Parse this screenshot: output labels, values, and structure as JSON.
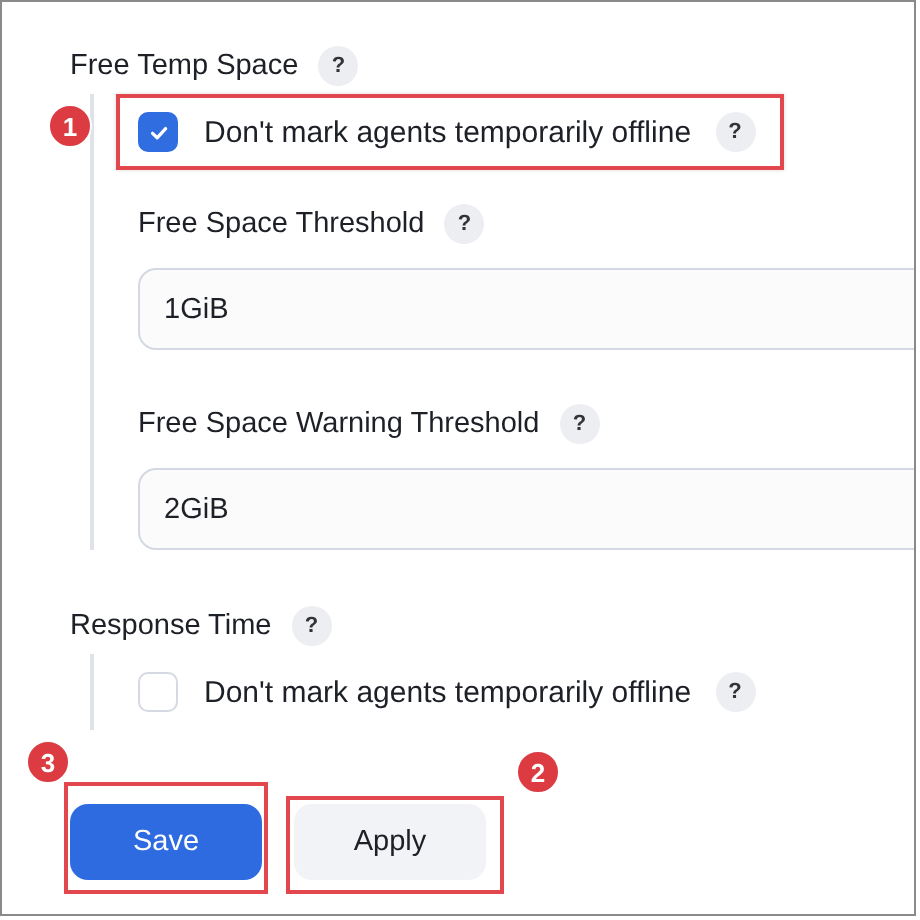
{
  "sections": [
    {
      "title": "Free Temp Space",
      "help": "?",
      "checkbox": {
        "label": "Don't mark agents temporarily offline",
        "help": "?",
        "checked": true,
        "highlighted": true,
        "marker": "1"
      },
      "fields": [
        {
          "label": "Free Space Threshold",
          "help": "?",
          "value": "1GiB"
        },
        {
          "label": "Free Space Warning Threshold",
          "help": "?",
          "value": "2GiB"
        }
      ]
    },
    {
      "title": "Response Time",
      "help": "?",
      "checkbox": {
        "label": "Don't mark agents temporarily offline",
        "help": "?",
        "checked": false,
        "highlighted": false
      }
    }
  ],
  "buttons": [
    {
      "label": "Save",
      "kind": "primary",
      "highlighted": true,
      "marker": "3"
    },
    {
      "label": "Apply",
      "kind": "secondary",
      "highlighted": true,
      "marker": "2"
    }
  ]
}
